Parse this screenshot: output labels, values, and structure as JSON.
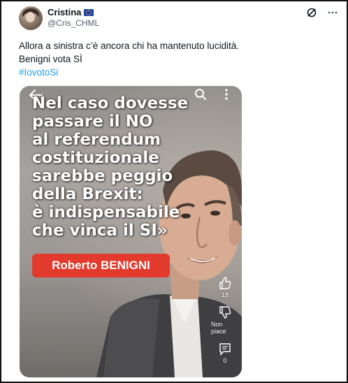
{
  "author": {
    "name": "Cristina",
    "handle": "@Cris_CHML",
    "flag_icon": "eu-flag-icon"
  },
  "tweet": {
    "line1": "Allora a sinistra c’è ancora chi ha mantenuto lucidità.",
    "line2": "Benigni vota SÌ",
    "hashtag": "#IovotoSi"
  },
  "media": {
    "caption_lines": [
      "Nel caso dovesse",
      "passare il NO",
      "al referendum",
      "costituzionale",
      "sarebbe peggio",
      "della Brexit:",
      "è indispensabile",
      "che vinca il SI»"
    ],
    "name_badge": "Roberto BENIGNI",
    "like_count": "18",
    "dislike_label": "Non piace",
    "comment_count": "0"
  },
  "colors": {
    "hashtag": "#1d9bf0",
    "badge": "#e23a2c",
    "text": "#0f1419",
    "secondary": "#536471"
  }
}
